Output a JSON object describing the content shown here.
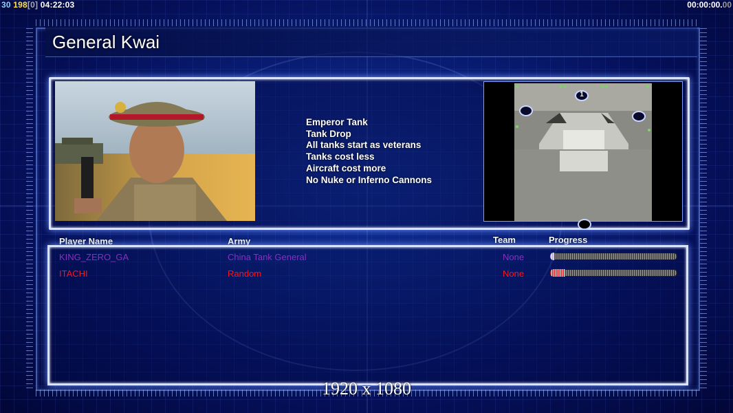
{
  "hud": {
    "fps": "30",
    "ping": "198",
    "ping_extra": "[0]",
    "clock": "04:22:03",
    "timer_main": "00:00:00.",
    "timer_ms": "00"
  },
  "general": {
    "name": "General Kwai",
    "features": [
      "Emperor Tank",
      "Tank Drop",
      "All tanks start as veterans",
      "Tanks cost less",
      "Aircraft cost more",
      "No Nuke or Inferno Cannons"
    ]
  },
  "map": {
    "marker_label": "1"
  },
  "players": {
    "headers": {
      "name": "Player Name",
      "army": "Army",
      "team": "Team",
      "progress": "Progress"
    },
    "rows": [
      {
        "name": "KING_ZERO_GA",
        "army": "China Tank General",
        "team": "None",
        "color": "#8a2fc2",
        "progress": 0.03,
        "fill": "#b8a6ff"
      },
      {
        "name": "ITACHI",
        "army": "Random",
        "team": "None",
        "color": "#ff1414",
        "progress": 0.12,
        "fill": "#e02a2a"
      }
    ]
  },
  "resolution": "1920 x 1080",
  "colors": {
    "panel_border": "#d8e4ff",
    "glow": "#6f93ff",
    "background": "#0a1f78"
  }
}
